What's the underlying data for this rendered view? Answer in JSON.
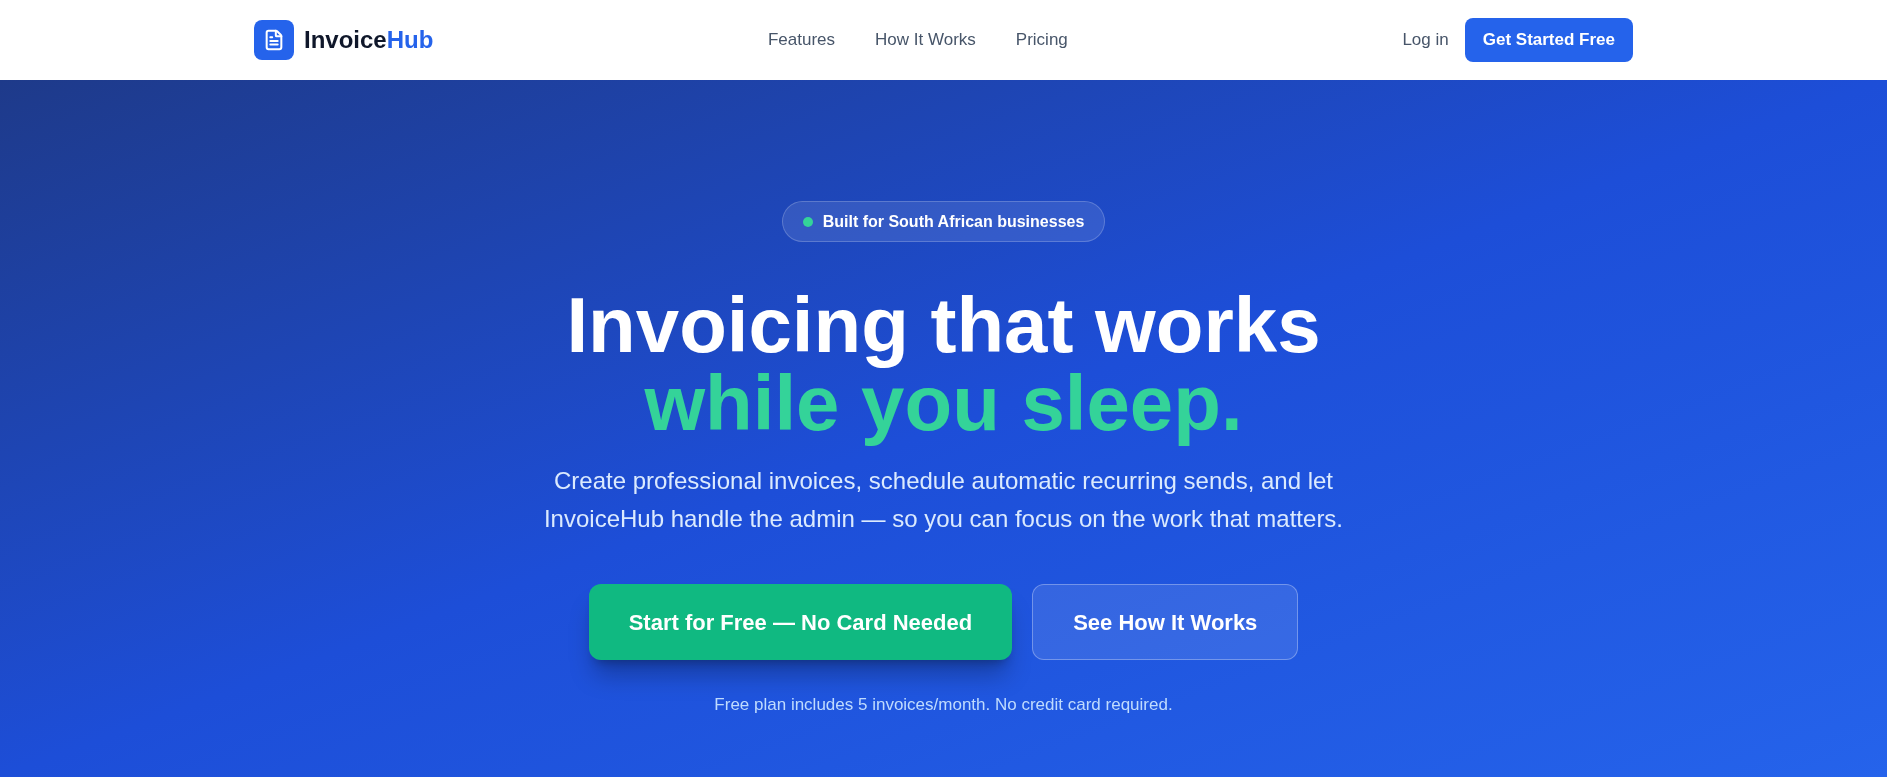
{
  "header": {
    "logo": {
      "name": "Invoice",
      "name_accent": "Hub"
    },
    "nav_links": [
      "Features",
      "How It Works",
      "Pricing"
    ],
    "login_link": "Log in",
    "cta_button": "Get Started Free"
  },
  "hero": {
    "badge": "Built for South African businesses",
    "headline": {
      "line_1": "Invoicing that works",
      "line_2": "while you sleep."
    },
    "description": "Create professional invoices, schedule automatic recurring sends, and let InvoiceHub handle the admin — so you can focus on the work that matters.",
    "buttons": [
      {
        "label": "Start for Free — No Card Needed",
        "kind": "primary"
      },
      {
        "label": "See How It Works",
        "kind": "secondary"
      }
    ],
    "note": "Free plan includes 5 invoices/month. No credit card required."
  }
}
